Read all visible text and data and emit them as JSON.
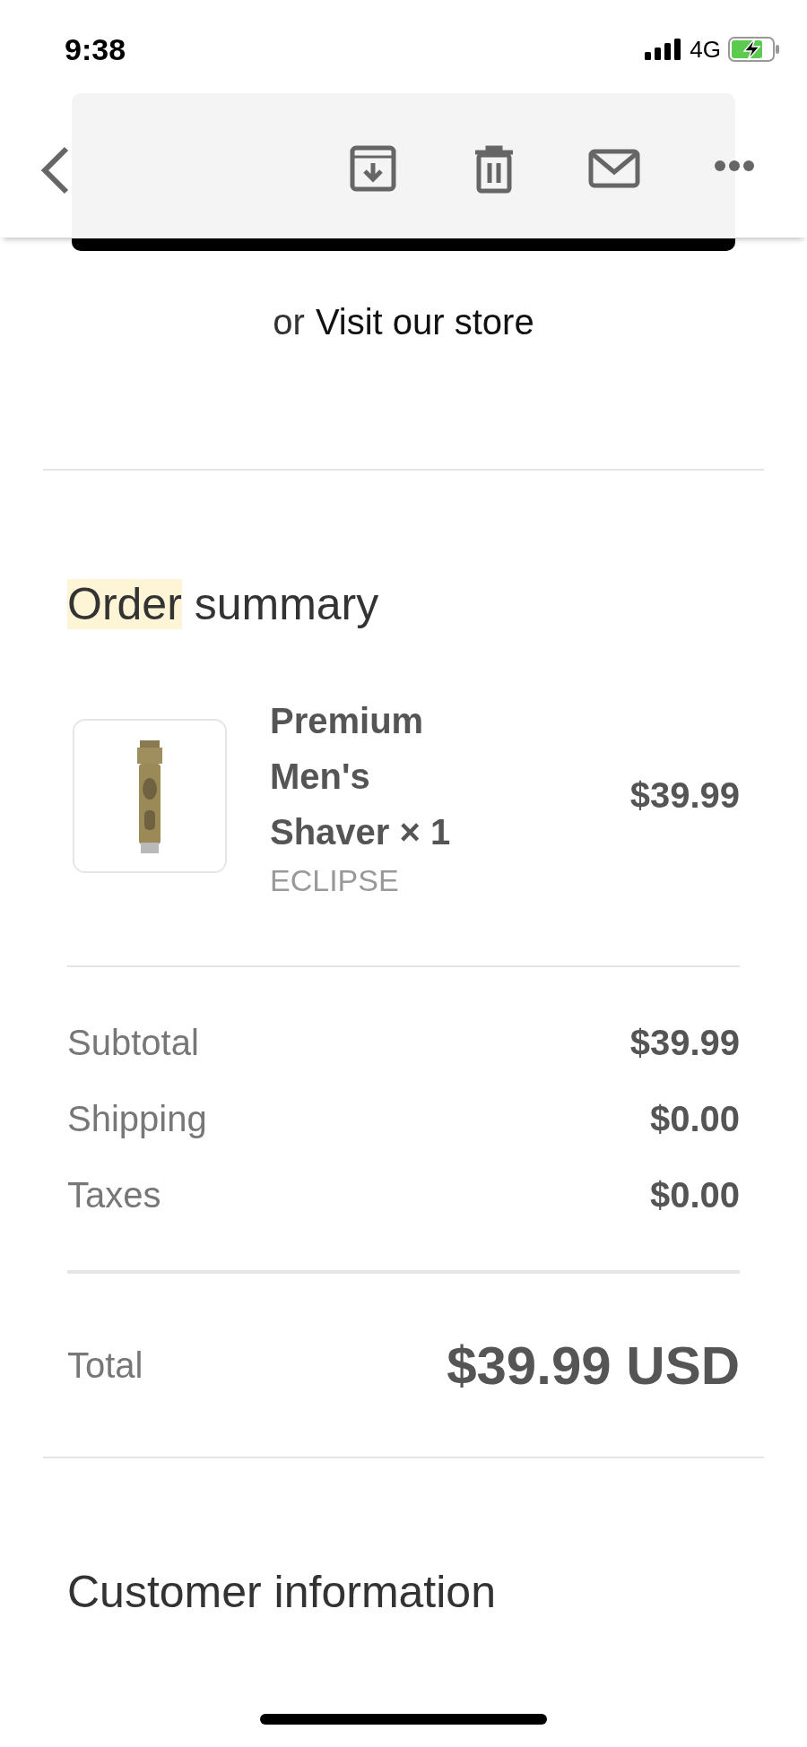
{
  "status_bar": {
    "time": "9:38",
    "network": "4G"
  },
  "store_link": {
    "prefix": "or",
    "link": "Visit our store"
  },
  "order_summary": {
    "heading_parts": [
      {
        "text": "Order",
        "highlighted": true
      },
      {
        "text": " summary",
        "highlighted": false
      }
    ],
    "items": [
      {
        "kind": "picture",
        "title": "Premium Men's Shaver × 1",
        "vendor": "ECLIPSE",
        "price": "$39.99"
      }
    ],
    "lines": [
      {
        "label": "Subtotal",
        "value": "$39.99"
      },
      {
        "label": "Shipping",
        "value": "$0.00"
      },
      {
        "label": "Taxes",
        "value": "$0.00"
      }
    ],
    "total": {
      "label": "Total",
      "value": "$39.99 USD"
    }
  },
  "customer_information": {
    "heading": "Customer information"
  }
}
